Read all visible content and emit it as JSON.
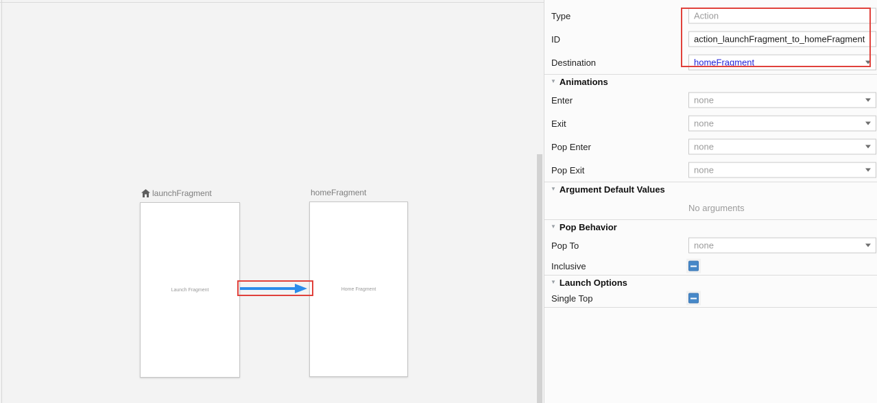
{
  "canvas": {
    "fragments": [
      {
        "name": "launchFragment",
        "preview": "Launch Fragment",
        "start_destination": true
      },
      {
        "name": "homeFragment",
        "preview": "Home Fragment",
        "start_destination": false
      }
    ],
    "action_arrow": {
      "from": "launchFragment",
      "to": "homeFragment"
    }
  },
  "panel": {
    "type_label": "Type",
    "type_value": "Action",
    "id_label": "ID",
    "id_value": "action_launchFragment_to_homeFragment",
    "destination_label": "Destination",
    "destination_value": "homeFragment",
    "animations": {
      "title": "Animations",
      "enter_label": "Enter",
      "enter_value": "none",
      "exit_label": "Exit",
      "exit_value": "none",
      "pop_enter_label": "Pop Enter",
      "pop_enter_value": "none",
      "pop_exit_label": "Pop Exit",
      "pop_exit_value": "none"
    },
    "arguments": {
      "title": "Argument Default Values",
      "empty_text": "No arguments"
    },
    "pop_behavior": {
      "title": "Pop Behavior",
      "pop_to_label": "Pop To",
      "pop_to_value": "none",
      "inclusive_label": "Inclusive"
    },
    "launch_options": {
      "title": "Launch Options",
      "single_top_label": "Single Top"
    }
  },
  "colors": {
    "arrow_blue": "#2b8ceb",
    "annotation_red": "#e0403a",
    "checkbox_blue": "#4788c8",
    "destination_link_blue": "#2323d8",
    "canvas_bg": "#f3f3f3",
    "panel_bg": "#fbfbfb"
  }
}
